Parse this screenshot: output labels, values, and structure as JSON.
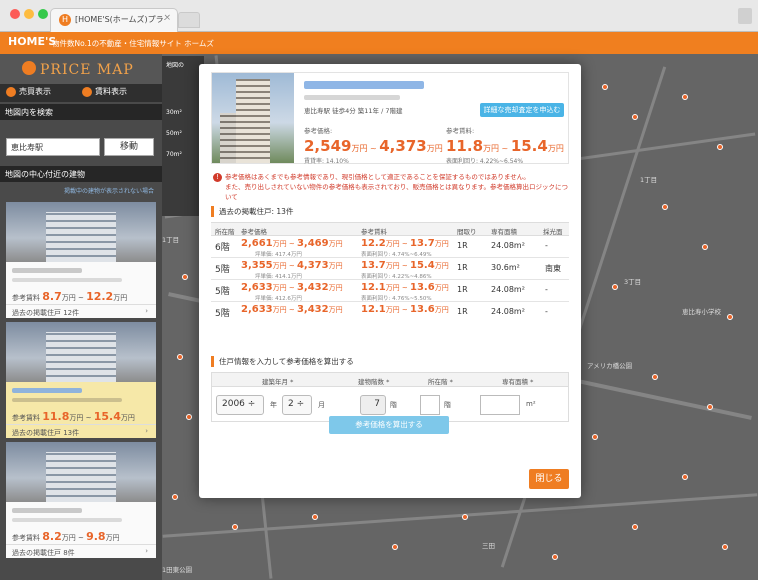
{
  "browser": {
    "tab_title": "[HOME'S(ホームズ)プライ",
    "tab_close": "×",
    "favicon": "H"
  },
  "header": {
    "logo": "HOME'S",
    "tagline": "物件数No.1の不動産・住宅情報サイト ホームズ"
  },
  "sidebar": {
    "logo_text": "PRICE MAP",
    "mode_sale": "売買表示",
    "mode_rent": "賃料表示",
    "search_heading": "地図内を検索",
    "search_value": "恵比寿駅",
    "move_button": "移動",
    "nearby_heading": "地図の中心付近の建物",
    "note_link": "掲載中の建物が表示されない場合",
    "cards": [
      {
        "price_label": "参考賃料",
        "low": "8.7",
        "high": "12.2",
        "unit": "万円",
        "foot": "過去の掲載住戸 12件"
      },
      {
        "price_label": "参考賃料",
        "low": "11.8",
        "high": "15.4",
        "unit": "万円",
        "foot": "過去の掲載住戸 13件"
      },
      {
        "price_label": "参考賃料",
        "low": "8.2",
        "high": "9.8",
        "unit": "万円",
        "foot": "過去の掲載住戸 8件"
      }
    ]
  },
  "map": {
    "legend_top": "地図の",
    "legend_items": [
      "30m²",
      "50m²",
      "70m²"
    ],
    "labels": [
      "1丁目",
      "3丁目",
      "1丁目",
      "アメリカ橋公園",
      "三田",
      "恵比寿小学校",
      "1田東公園"
    ]
  },
  "modal": {
    "info": "恵比寿駅 徒歩4分   築11年 / 7階建",
    "assess_button": "詳細な売却査定を申込む",
    "sale": {
      "label": "参考価格:",
      "low": "2,549",
      "high": "4,373",
      "unit": "万円",
      "sub": "賃貸率: 14.10%"
    },
    "rent": {
      "label": "参考賃料:",
      "low": "11.8",
      "high": "15.4",
      "unit": "万円",
      "sub": "表面利回り: 4.22%~6.54%"
    },
    "warning_line1": "参考価格はあくまでも参考情報であり、現引価格として適正であることを保証するものではありません。",
    "warning_line2": "また、売り出しされていない物件の参考価格も表示されており、販売価格とは異なります。参考価格算出ロジックについて",
    "past_title": "過去の掲載住戸: 13件",
    "table_headers": [
      "所在階",
      "参考価格",
      "参考賃料",
      "間取り",
      "専有面積",
      "採光面"
    ],
    "rows": [
      {
        "floor": "6階",
        "p_low": "2,661",
        "p_high": "3,469",
        "p_sub": "坪単価: 417.4万円",
        "r_low": "12.2",
        "r_high": "13.7",
        "r_sub": "表面利回り: 4.74%~6.49%",
        "layout": "1R",
        "area": "24.08m²",
        "dir": "-"
      },
      {
        "floor": "5階",
        "p_low": "3,355",
        "p_high": "4,373",
        "p_sub": "坪単価: 414.1万円",
        "r_low": "13.7",
        "r_high": "15.4",
        "r_sub": "表面利回り: 4.22%~4.86%",
        "layout": "1R",
        "area": "30.6m²",
        "dir": "南東"
      },
      {
        "floor": "5階",
        "p_low": "2,633",
        "p_high": "3,432",
        "p_sub": "坪単価: 412.6万円",
        "r_low": "12.1",
        "r_high": "13.6",
        "r_sub": "表面利回り: 4.76%~5.50%",
        "layout": "1R",
        "area": "24.08m²",
        "dir": "-"
      },
      {
        "floor": "5階",
        "p_low": "2,633",
        "p_high": "3,432",
        "p_sub": "",
        "r_low": "12.1",
        "r_high": "13.6",
        "r_sub": "",
        "layout": "1R",
        "area": "24.08m²",
        "dir": "-"
      }
    ],
    "unit_man": "万円",
    "calc_title": "住戸情報を入力して参考価格を算出する",
    "calc_headers": [
      "建築年月 *",
      "建物階数 *",
      "所在階 *",
      "専有面積 *"
    ],
    "calc": {
      "year": "2006 ÷",
      "year_unit": "年",
      "month": "2 ÷",
      "month_unit": "月",
      "floors": "7",
      "floors_unit": "階",
      "floor_unit": "階",
      "area_unit": "m²"
    },
    "calc_button": "参考価格を算出する",
    "close_button": "閉じる"
  },
  "colors": {
    "accent": "#ef7d22",
    "price": "#e8652a",
    "link": "#4ab4e6"
  }
}
